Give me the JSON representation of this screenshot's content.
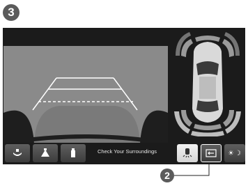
{
  "step_number": "3",
  "callout_number": "2",
  "toolbar": {
    "status_text": "Check Your Surroundings",
    "buttons": [
      {
        "icon": "top-view-camera-icon"
      },
      {
        "icon": "normal-view-camera-icon"
      },
      {
        "icon": "wide-view-camera-icon"
      },
      {
        "icon": "parking-sensor-icon"
      },
      {
        "icon": "guideline-toggle-icon"
      },
      {
        "icon": "day-night-icon",
        "glyph": "☀☽"
      }
    ]
  },
  "colors": {
    "screen_bg": "#1b1b1b",
    "camera_bg": "#8a8a8a",
    "guideline": "#ffffff",
    "sensor_arc": "#9a9a9a"
  }
}
